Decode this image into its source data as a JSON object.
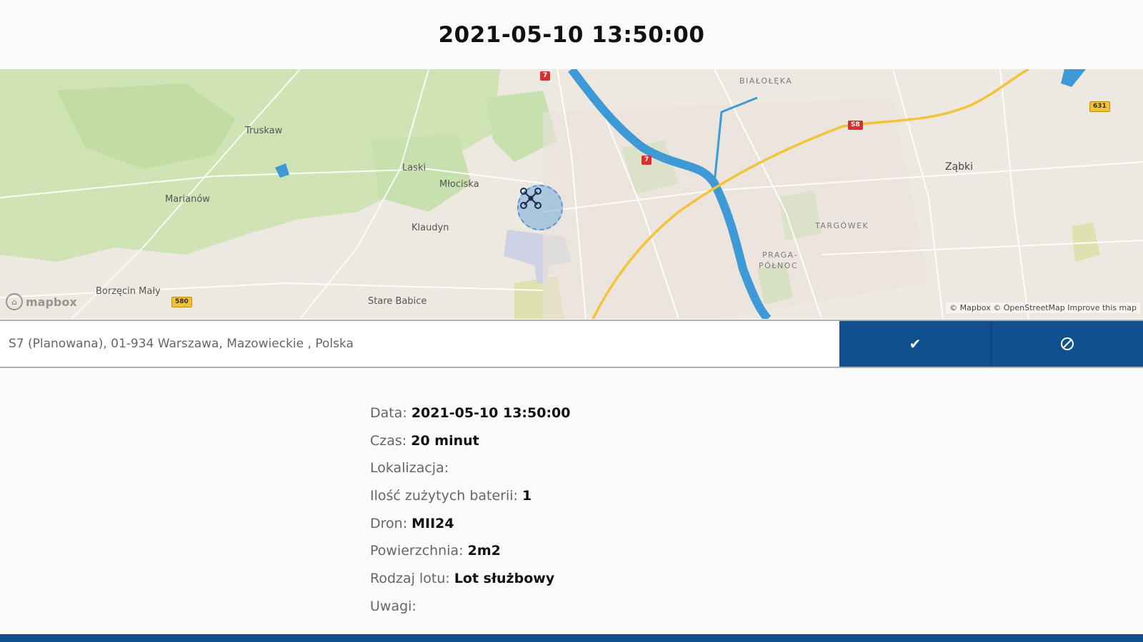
{
  "header": {
    "title": "2021-05-10 13:50:00"
  },
  "map": {
    "labels": {
      "bialoleka": "BIAŁOŁĘKA",
      "truskaw": "Truskaw",
      "laski": "Laski",
      "mlociska": "Młociska",
      "marianow": "Marianów",
      "klaudyn": "Klaudyn",
      "zabki": "Ząbki",
      "targowek": "TARGÓWEK",
      "praga1": "PRAGA-",
      "praga2": "PÓŁNOC",
      "borzecin": "Borzęcin Mały",
      "stare_babice": "Stare Babice"
    },
    "road_badges": {
      "r1": "7",
      "r2": "7",
      "r3": "S8",
      "r4": "631",
      "r5": "580"
    },
    "logo_text": "mapbox",
    "attribution": "© Mapbox © OpenStreetMap Improve this map",
    "marker_icon": "drone-icon"
  },
  "address": {
    "value": "S7 (Planowana), 01-934 Warszawa, Mazowieckie , Polska",
    "confirm_icon": "check-icon",
    "cancel_icon": "cancel-icon"
  },
  "details": {
    "date_label": "Data:",
    "date_value": "2021-05-10 13:50:00",
    "time_label": "Czas:",
    "time_value": "20 minut",
    "location_label": "Lokalizacja:",
    "location_value": "",
    "batteries_label": "Ilość zużytych baterii:",
    "batteries_value": "1",
    "drone_label": "Dron:",
    "drone_value": "MII24",
    "area_label": "Powierzchnia:",
    "area_value": "2m2",
    "flight_type_label": "Rodzaj lotu:",
    "flight_type_value": "Lot służbowy",
    "notes_label": "Uwagi:",
    "notes_value": ""
  },
  "colors": {
    "primary": "#11508f",
    "map_base": "#ede8e0",
    "forest": "#cfe3b4",
    "water": "#3e9ad6",
    "road_major": "#f3c43a"
  }
}
